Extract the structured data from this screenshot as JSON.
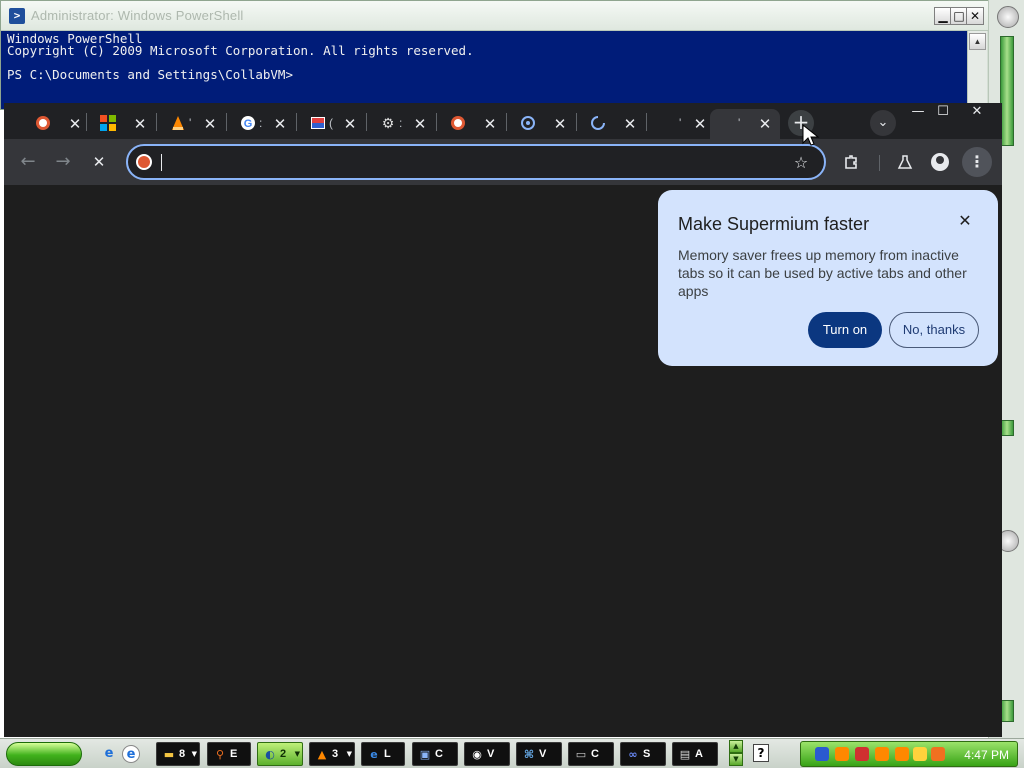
{
  "powershell": {
    "title": "Administrator: Windows PowerShell",
    "lines": [
      "Windows PowerShell",
      "Copyright (C) 2009 Microsoft Corporation. All rights reserved.",
      "",
      "PS C:\\Documents and Settings\\CollabVM>"
    ],
    "controls": {
      "minimize": "▁",
      "maximize": "□",
      "close": "✕"
    }
  },
  "browser": {
    "tabs": [
      {
        "icon": "duckduckgo-icon",
        "title": ""
      },
      {
        "icon": "microsoft-icon",
        "title": ""
      },
      {
        "icon": "vlc-icon",
        "title": "'"
      },
      {
        "icon": "google-icon",
        "title": ":"
      },
      {
        "icon": "image-icon",
        "title": "("
      },
      {
        "icon": "gear-icon",
        "title": ":"
      },
      {
        "icon": "duckduckgo-icon",
        "title": ""
      },
      {
        "icon": "globe-icon",
        "title": ""
      },
      {
        "icon": "loading-spinner-icon",
        "title": ""
      },
      {
        "icon": "blank-icon",
        "title": "'"
      },
      {
        "icon": "blank-icon",
        "title": "'"
      }
    ],
    "new_tab_label": "+",
    "tab_search_label": "⌄",
    "window_controls": {
      "minimize": "—",
      "maximize": "☐",
      "close": "✕"
    },
    "omnibox": {
      "value": "",
      "placeholder": ""
    },
    "nav": {
      "back": "←",
      "forward": "→",
      "stop": "✕"
    }
  },
  "bubble": {
    "title": "Make Supermium faster",
    "body": "Memory saver frees up memory from inactive tabs so it can be used by active tabs and other apps",
    "primary": "Turn on",
    "secondary": "No, thanks",
    "close": "✕",
    "accent": "#d3e3fd",
    "primary_color": "#0b3780"
  },
  "taskbar": {
    "tasks": [
      {
        "icon": "folder-icon",
        "label": "8",
        "group": true
      },
      {
        "icon": "search-icon",
        "label": "E",
        "group": false
      },
      {
        "icon": "network-icon",
        "label": "2",
        "group": true,
        "active": true
      },
      {
        "icon": "vlc-icon",
        "label": "3",
        "group": true
      },
      {
        "icon": "ie-icon",
        "label": "L",
        "group": false
      },
      {
        "icon": "computer-icon",
        "label": "C",
        "group": false
      },
      {
        "icon": "media-icon",
        "label": "V",
        "group": false
      },
      {
        "icon": "network-places-icon",
        "label": "V",
        "group": false
      },
      {
        "icon": "cmd-icon",
        "label": "C",
        "group": false
      },
      {
        "icon": "link-icon",
        "label": "S",
        "group": false
      },
      {
        "icon": "document-icon",
        "label": "A",
        "group": false
      }
    ],
    "help_label": "?",
    "clock": "4:47 PM"
  }
}
